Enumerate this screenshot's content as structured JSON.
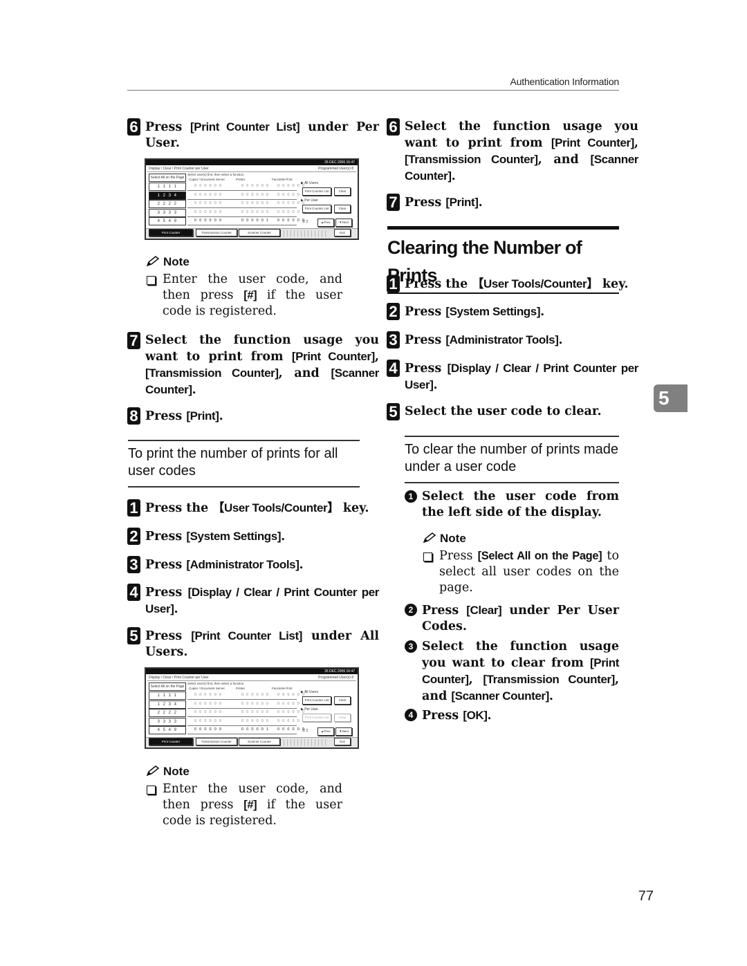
{
  "header": {
    "running_head": "Authentication Information"
  },
  "chapter_tab": "5",
  "page_number": "77",
  "left_column": {
    "step6": {
      "num": "6",
      "pre": "Press ",
      "kw": "[Print Counter List]",
      "post": " under Per User."
    },
    "panel1": {
      "datetime": "26 DEC  2006 16:47",
      "title": "Display / Clear / Print Counter per User",
      "programmed": "Programmed User(s)    8",
      "select_all": "Select All on the Page",
      "instruction": "Select user(s) first, then select a function.",
      "columns": [
        "Copier / Document Server",
        "Printer",
        "Facsimile Print"
      ],
      "rows": [
        {
          "code": "1 1 1 1",
          "values": [
            "0 0 0 0 0 0",
            "0 0 0 0 0 0",
            "0 0 0 0 0 0"
          ],
          "selected": false
        },
        {
          "code": "1 2 3 4",
          "values": [
            "0 0 0 0 0 0",
            "0 0 0 0 0 0",
            "0 0 0 0 0 0"
          ],
          "selected": true
        },
        {
          "code": "2 2 2 2",
          "values": [
            "0 0 0 0 0 0",
            "0 0 0 0 0 0",
            "0 0 0 0 0 0"
          ],
          "selected": false
        },
        {
          "code": "3 3 3 3",
          "values": [
            "0 0 0 0 0 0",
            "0 0 0 0 0 0",
            "0 0 0 0 0 0"
          ],
          "selected": false
        },
        {
          "code": "4 5 4 9",
          "values": [
            "0 0 0 0 0 0",
            "0 0 0 0 0 1",
            "0 0 0 0 0 0"
          ],
          "selected": false
        }
      ],
      "all_users_label": "▶ All Users",
      "per_user_label": "▶ Per User",
      "print_counter_list": "Print Counter List",
      "clear": "Clear",
      "pager": "1/  2",
      "prev": "▲Prev.",
      "next": "▼Next",
      "tabs": [
        "Print Counter",
        "Transmission Counter",
        "Scanner Counter"
      ],
      "exit": "Exit",
      "per_user_enabled": true
    },
    "note1": {
      "title": "Note",
      "pre": "Enter the user code, and then press ",
      "kw": "[#]",
      "post": " if the user code is registered."
    },
    "step7": {
      "num": "7",
      "t1": "Select the function usage you want to print from ",
      "k1": "[Print Counter]",
      "t2": ", ",
      "k2": "[Transmission Counter]",
      "t3": ", and ",
      "k3": "[Scanner Counter]",
      "t4": "."
    },
    "step8": {
      "num": "8",
      "pre": "Press ",
      "kw": "[Print]",
      "post": "."
    },
    "subhead": "To print the number of prints for all user codes",
    "s1": {
      "num": "1",
      "pre": "Press the ",
      "kw": "【User Tools/Counter】",
      "post": " key."
    },
    "s2": {
      "num": "2",
      "pre": "Press ",
      "kw": "[System Settings]",
      "post": "."
    },
    "s3": {
      "num": "3",
      "pre": "Press ",
      "kw": "[Administrator Tools]",
      "post": "."
    },
    "s4": {
      "num": "4",
      "pre": "Press ",
      "kw": "[Display / Clear / Print Counter per User]",
      "post": "."
    },
    "s5": {
      "num": "5",
      "pre": "Press ",
      "kw": "[Print Counter List]",
      "post": " under All Users."
    },
    "panel2": {
      "datetime": "26 DEC  2006 16:47",
      "title": "Display / Clear / Print Counter per User",
      "programmed": "Programmed User(s)    8",
      "select_all": "Select All on the Page",
      "instruction": "Select user(s) first, then select a function.",
      "columns": [
        "Copier / Document Server",
        "Printer",
        "Facsimile Print"
      ],
      "rows": [
        {
          "code": "1 1 1 1",
          "values": [
            "0 0 0 0 0 0",
            "0 0 0 0 0 0",
            "0 0 0 0 0 0"
          ],
          "selected": false
        },
        {
          "code": "1 2 3 4",
          "values": [
            "0 0 0 0 0 0",
            "0 0 0 0 0 0",
            "0 0 0 0 0 0"
          ],
          "selected": false
        },
        {
          "code": "2 2 2 2",
          "values": [
            "0 0 0 0 0 0",
            "0 0 0 0 0 0",
            "0 0 0 0 0 0"
          ],
          "selected": false
        },
        {
          "code": "3 3 3 3",
          "values": [
            "0 0 0 0 0 0",
            "0 0 0 0 0 0",
            "0 0 0 0 0 0"
          ],
          "selected": false
        },
        {
          "code": "4 5 4 9",
          "values": [
            "0 0 0 0 0 0",
            "0 0 0 0 0 1",
            "0 0 0 0 0 0"
          ],
          "selected": false
        }
      ],
      "all_users_label": "▶ All Users",
      "per_user_label": "▶ Per User",
      "print_counter_list": "Print Counter List",
      "clear": "Clear",
      "pager": "1/  2",
      "prev": "▲Prev.",
      "next": "▼Next",
      "tabs": [
        "Print Counter",
        "Transmission Counter",
        "Scanner Counter"
      ],
      "exit": "Exit",
      "per_user_enabled": false
    },
    "note2": {
      "title": "Note",
      "pre": "Enter the user code, and then press ",
      "kw": "[#]",
      "post": " if the user code is registered."
    }
  },
  "right_column": {
    "step6": {
      "num": "6",
      "t1": "Select the function usage you want to print from ",
      "k1": "[Print Counter]",
      "t2": ", ",
      "k2": "[Transmission Counter]",
      "t3": ", and ",
      "k3": "[Scanner Counter]",
      "t4": "."
    },
    "step7": {
      "num": "7",
      "pre": "Press ",
      "kw": "[Print]",
      "post": "."
    },
    "section_title": "Clearing the Number of Prints",
    "s1": {
      "num": "1",
      "pre": "Press the ",
      "kw": "【User Tools/Counter】",
      "post": " key."
    },
    "s2": {
      "num": "2",
      "pre": "Press ",
      "kw": "[System Settings]",
      "post": "."
    },
    "s3": {
      "num": "3",
      "pre": "Press ",
      "kw": "[Administrator Tools]",
      "post": "."
    },
    "s4": {
      "num": "4",
      "pre": "Press ",
      "kw": "[Display / Clear / Print Counter per User]",
      "post": "."
    },
    "s5": {
      "num": "5",
      "text": "Select the user code to clear."
    },
    "subhead": "To clear the number of prints made under a user code",
    "sub1": {
      "num": "1",
      "text": "Select the user code from the left side of the display."
    },
    "note": {
      "title": "Note",
      "pre": "Press ",
      "kw": "[Select All on the Page]",
      "post": " to select all user codes on the page."
    },
    "sub2": {
      "num": "2",
      "pre": "Press ",
      "kw": "[Clear]",
      "post": " under Per User Codes."
    },
    "sub3": {
      "num": "3",
      "t1": "Select the function usage you want to clear from ",
      "k1": "[Print Counter]",
      "t2": ", ",
      "k2": "[Transmission Counter]",
      "t3": ", and ",
      "k3": "[Scanner Counter]",
      "t4": "."
    },
    "sub4": {
      "num": "4",
      "pre": "Press ",
      "kw": "[OK]",
      "post": "."
    }
  }
}
